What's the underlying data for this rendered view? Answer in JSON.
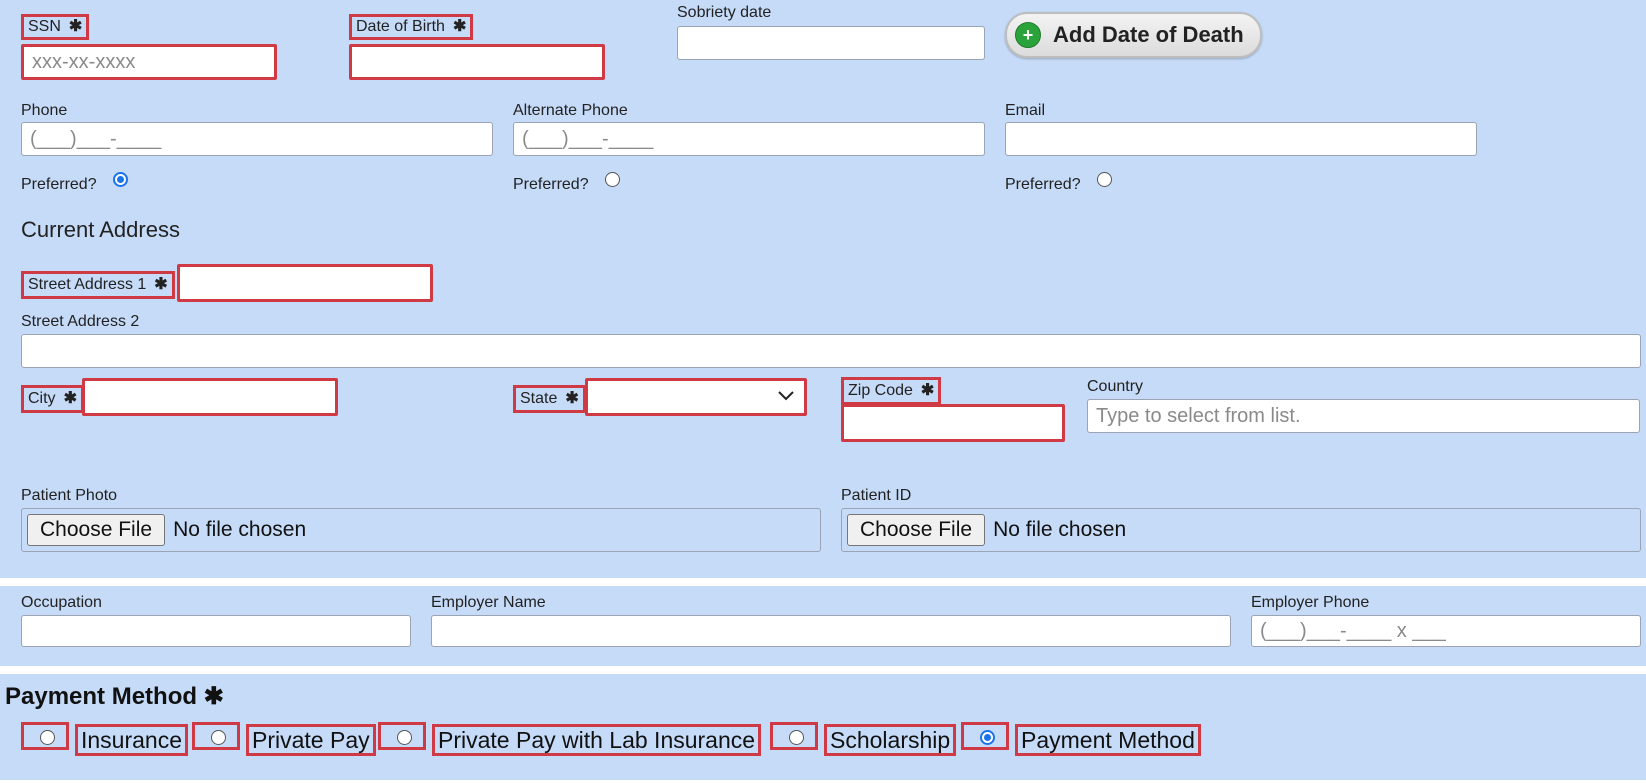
{
  "personal": {
    "ssn_label": "SSN",
    "ssn_placeholder": "xxx-xx-xxxx",
    "dob_label": "Date of Birth",
    "sobriety_label": "Sobriety date",
    "add_death_label": "Add Date of Death"
  },
  "contact": {
    "phone_label": "Phone",
    "phone_placeholder": "(___)___-____",
    "alt_phone_label": "Alternate Phone",
    "alt_phone_placeholder": "(___)___-____",
    "email_label": "Email",
    "preferred_label": "Preferred?",
    "preferred_selected": "phone"
  },
  "address": {
    "section_title": "Current Address",
    "street1_label": "Street Address 1",
    "street2_label": "Street Address 2",
    "city_label": "City",
    "state_label": "State",
    "zip_label": "Zip Code",
    "country_label": "Country",
    "country_placeholder": "Type to select from list."
  },
  "uploads": {
    "photo_label": "Patient Photo",
    "id_label": "Patient ID",
    "choose_file": "Choose File",
    "no_file": "No file chosen"
  },
  "employment": {
    "occupation_label": "Occupation",
    "employer_name_label": "Employer Name",
    "employer_phone_label": "Employer Phone",
    "employer_phone_placeholder": "(___)___-____ x ___"
  },
  "payment": {
    "title": "Payment Method",
    "options": [
      "Insurance",
      "Private Pay",
      "Private Pay with Lab Insurance",
      "Scholarship",
      "Payment Method"
    ],
    "selected": "Payment Method"
  },
  "required_star": "✱",
  "colors": {
    "background": "#c6dbf8",
    "required_outline": "#d03a45",
    "radio_selected": "#1a73e8"
  }
}
